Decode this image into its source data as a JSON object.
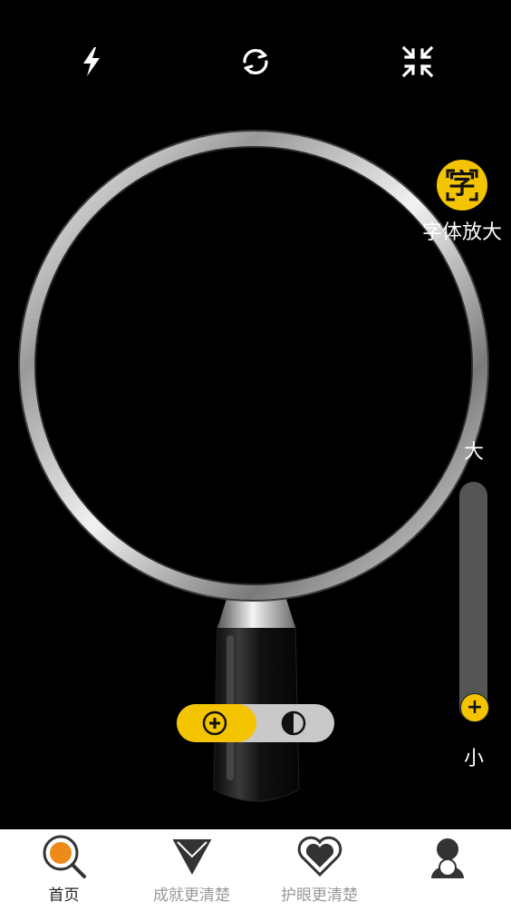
{
  "top_controls": {
    "flash": "flash-icon",
    "switch_camera": "refresh-icon",
    "collapse": "collapse-icon"
  },
  "font_enlarge": {
    "glyph": "字",
    "label": "字体放大"
  },
  "zoom": {
    "max_label": "大",
    "min_label": "小",
    "thumb_symbol": "+",
    "level": 0.0
  },
  "mode_toggle": {
    "options": [
      "magnify-icon",
      "contrast-icon"
    ],
    "selected": "magnify-icon"
  },
  "tabs": [
    {
      "label": "首页",
      "icon": "magnifier-icon",
      "active": true
    },
    {
      "label": "成就更清楚",
      "icon": "diamond-icon",
      "active": false
    },
    {
      "label": "护眼更清楚",
      "icon": "heart-icon",
      "active": false
    },
    {
      "label": "",
      "icon": "profile-icon",
      "active": false
    }
  ],
  "colors": {
    "accent": "#f5c400",
    "background": "#000000",
    "tab_active_icon": "#ee8a1a"
  }
}
